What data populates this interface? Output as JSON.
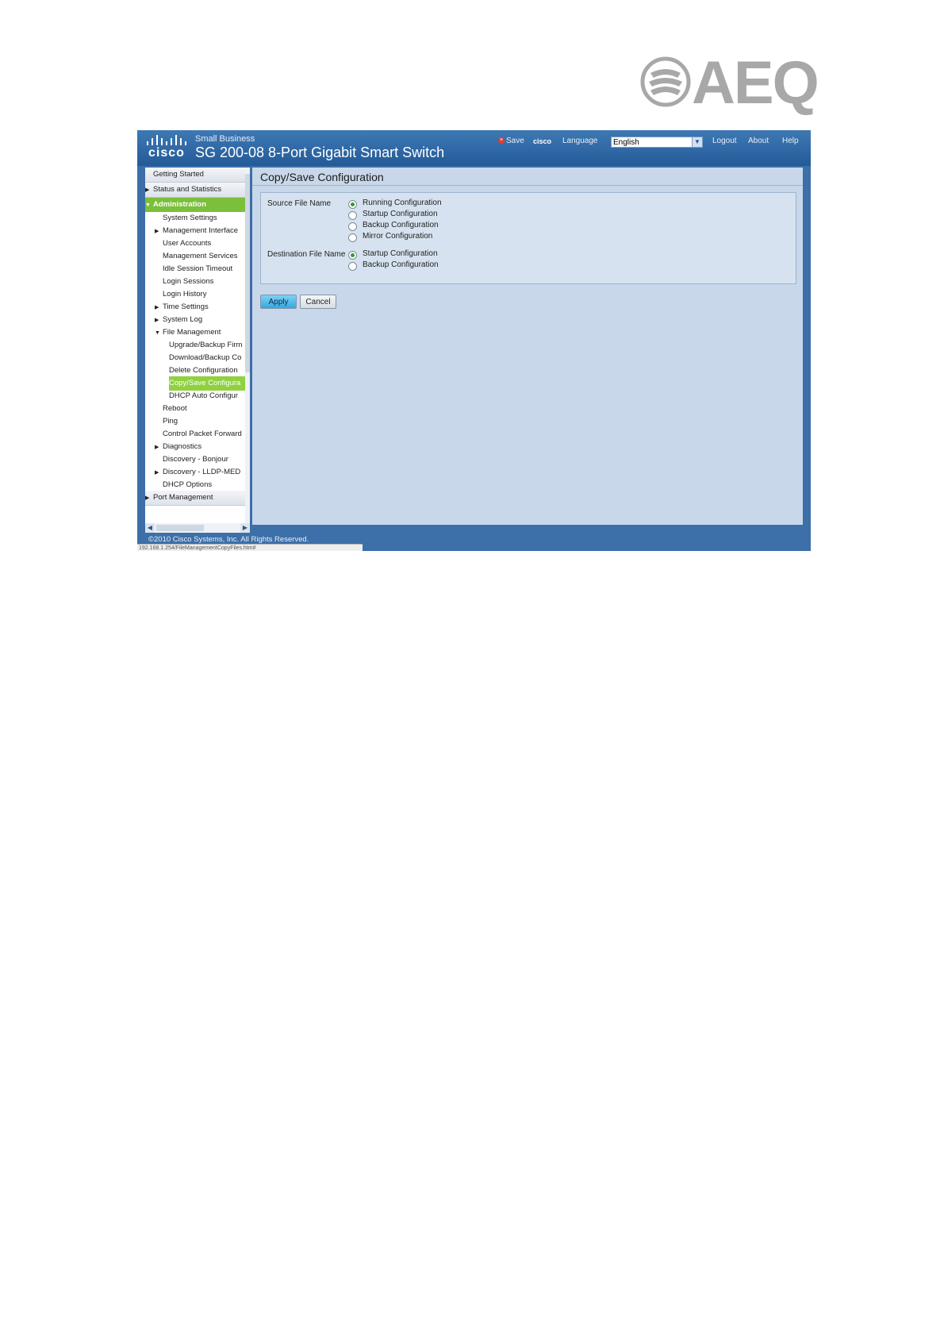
{
  "logo": {
    "text": "AEQ"
  },
  "header": {
    "brand_word": "cisco",
    "brand_sub": "Small Business",
    "product_title": "SG 200-08 8-Port Gigabit Smart Switch",
    "save_label": "Save",
    "cisco_label": "cisco",
    "language_label": "Language",
    "language_value": "English",
    "logout_label": "Logout",
    "about_label": "About",
    "help_label": "Help"
  },
  "nav": {
    "items": [
      {
        "label": "Getting Started"
      },
      {
        "label": "Status and Statistics"
      },
      {
        "label": "Administration"
      },
      {
        "label": "System Settings"
      },
      {
        "label": "Management Interface"
      },
      {
        "label": "User Accounts"
      },
      {
        "label": "Management Services"
      },
      {
        "label": "Idle Session Timeout"
      },
      {
        "label": "Login Sessions"
      },
      {
        "label": "Login History"
      },
      {
        "label": "Time Settings"
      },
      {
        "label": "System Log"
      },
      {
        "label": "File Management"
      },
      {
        "label": "Upgrade/Backup Firm"
      },
      {
        "label": "Download/Backup Co"
      },
      {
        "label": "Delete Configuration"
      },
      {
        "label": "Copy/Save Configura"
      },
      {
        "label": "DHCP Auto Configur"
      },
      {
        "label": "Reboot"
      },
      {
        "label": "Ping"
      },
      {
        "label": "Control Packet Forward"
      },
      {
        "label": "Diagnostics"
      },
      {
        "label": "Discovery - Bonjour"
      },
      {
        "label": "Discovery - LLDP-MED"
      },
      {
        "label": "DHCP Options"
      },
      {
        "label": "Port Management"
      }
    ]
  },
  "content": {
    "title": "Copy/Save Configuration",
    "source_label": "Source File Name",
    "source_options": [
      "Running Configuration",
      "Startup Configuration",
      "Backup Configuration",
      "Mirror Configuration"
    ],
    "destination_label": "Destination File Name",
    "destination_options": [
      "Startup Configuration",
      "Backup Configuration"
    ],
    "apply_label": "Apply",
    "cancel_label": "Cancel"
  },
  "footer": {
    "copyright": "©2010 Cisco Systems, Inc. All Rights Reserved.",
    "status_url": "192.168.1.254/FileManagementCopyFiles.htm#"
  }
}
